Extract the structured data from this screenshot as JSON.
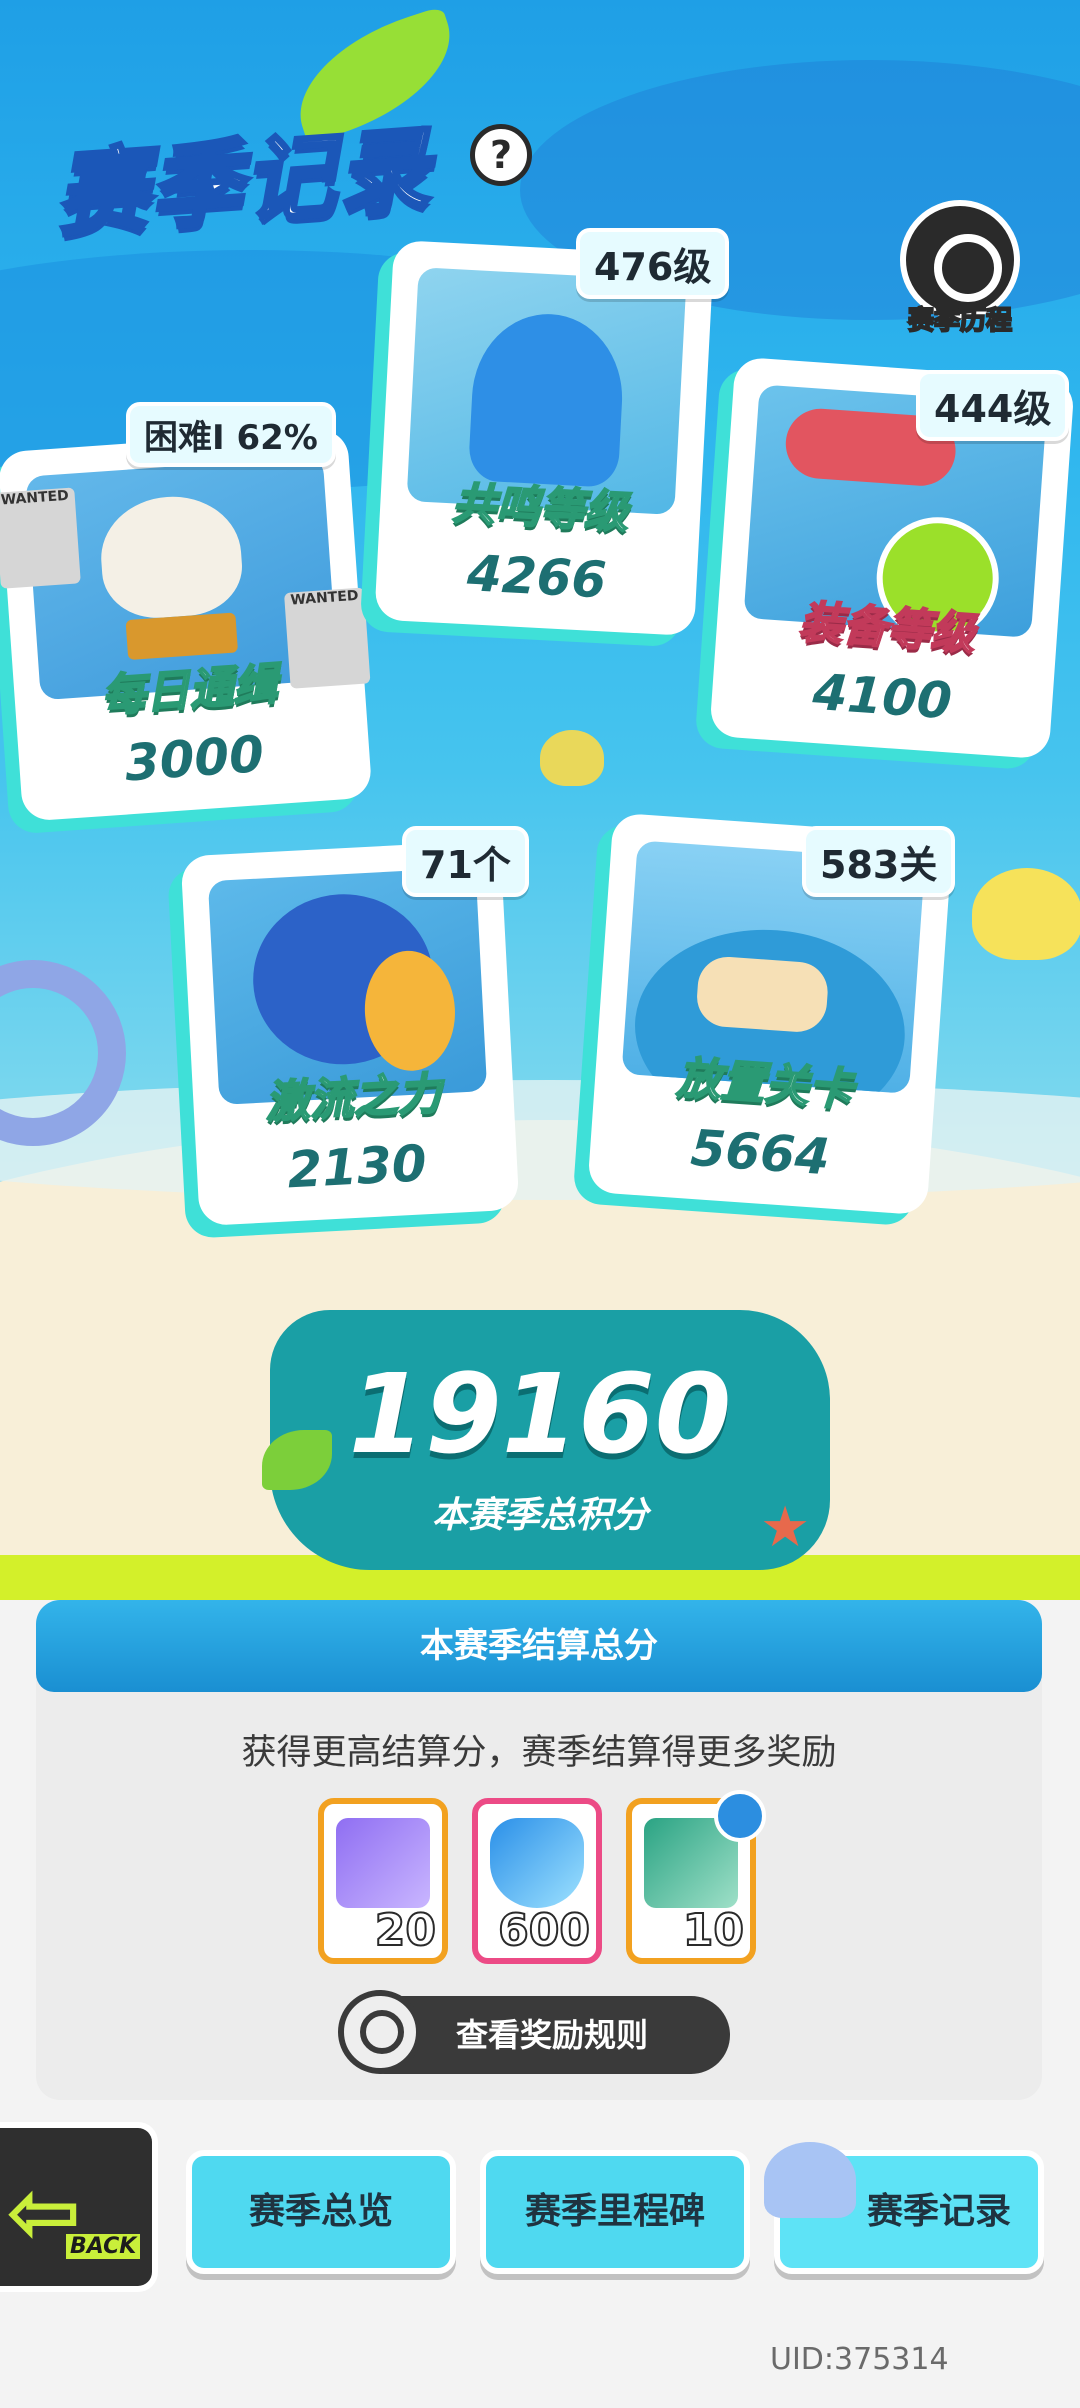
{
  "header": {
    "title": "赛季记录",
    "help_symbol": "?",
    "history_label": "赛季历程"
  },
  "cards": {
    "daily_wanted": {
      "name": "每日通缉",
      "value": "3000",
      "tag": "困难Ⅰ 62%",
      "wanted_text": "WANTED"
    },
    "resonance": {
      "name": "共鸣等级",
      "value": "4266",
      "tag": "476级"
    },
    "equipment": {
      "name": "装备等级",
      "value": "4100",
      "tag": "444级"
    },
    "torrent": {
      "name": "激流之力",
      "value": "2130",
      "tag": "71个"
    },
    "idle_stage": {
      "name": "放置关卡",
      "value": "5664",
      "tag": "583关"
    }
  },
  "total": {
    "value": "19160",
    "label": "本赛季总积分"
  },
  "settlement": {
    "title": "本赛季结算总分",
    "description": "获得更高结算分，赛季结算得更多奖励",
    "rewards": [
      {
        "icon": "purple-ticket-icon",
        "count": "20"
      },
      {
        "icon": "blue-diamond-icon",
        "count": "600"
      },
      {
        "icon": "green-ticket-icon",
        "count": "10"
      }
    ],
    "rules_button": "查看奖励规则"
  },
  "nav": {
    "back_label": "BACK",
    "tabs": [
      {
        "label": "赛季总览"
      },
      {
        "label": "赛季里程碑"
      },
      {
        "label": "赛季记录"
      }
    ]
  },
  "footer": {
    "uid": "UID:375314"
  },
  "colors": {
    "accent_teal": "#3fe0d8",
    "panel_header": "#1a8fd2",
    "reward_border_orange": "#f2a120",
    "reward_border_pink": "#ec4b86"
  }
}
